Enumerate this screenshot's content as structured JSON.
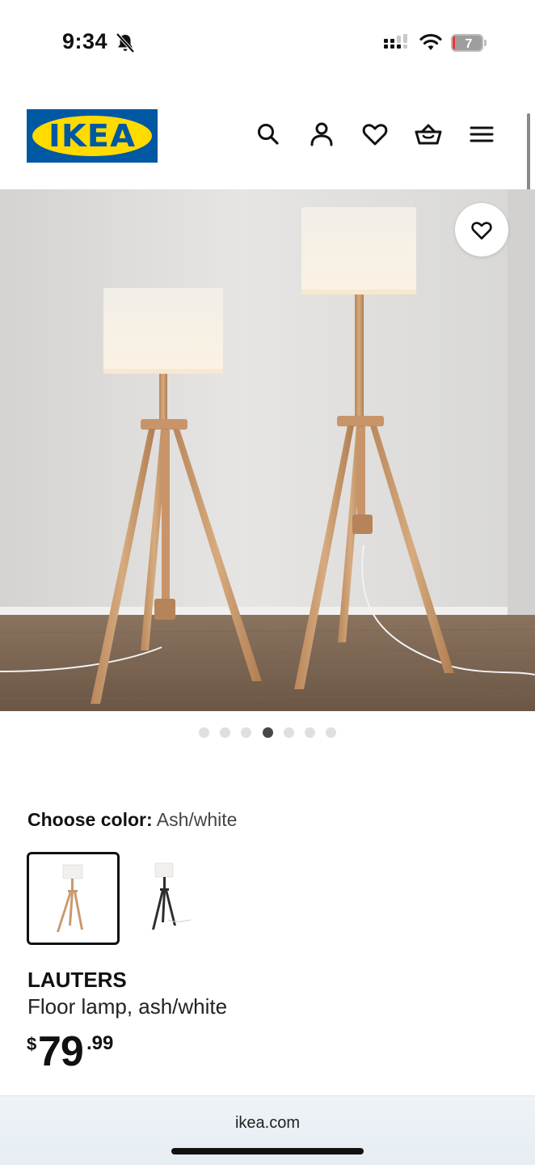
{
  "status_bar": {
    "time": "9:34",
    "battery_level": "7",
    "battery_fraction": 0.07,
    "icons": [
      "bell-slash-icon",
      "signal-icon",
      "wifi-icon",
      "battery-icon"
    ]
  },
  "header": {
    "logo_text": "IKEA",
    "icons": [
      "search-icon",
      "account-icon",
      "heart-icon",
      "cart-icon",
      "menu-icon"
    ],
    "colors": {
      "logo_blue": "#0058a3",
      "logo_yellow": "#ffdb00"
    }
  },
  "gallery": {
    "image_count": 7,
    "active_index": 3,
    "favorite_icon": "heart-icon"
  },
  "product": {
    "choose_color_label": "Choose color:",
    "selected_color": "Ash/white",
    "color_options": [
      "ash-white",
      "black-white"
    ],
    "name": "LAUTERS",
    "description": "Floor lamp, ash/white",
    "price_currency": "$",
    "price_integer": "79",
    "price_decimal": ".99"
  },
  "browser": {
    "url": "ikea.com"
  }
}
